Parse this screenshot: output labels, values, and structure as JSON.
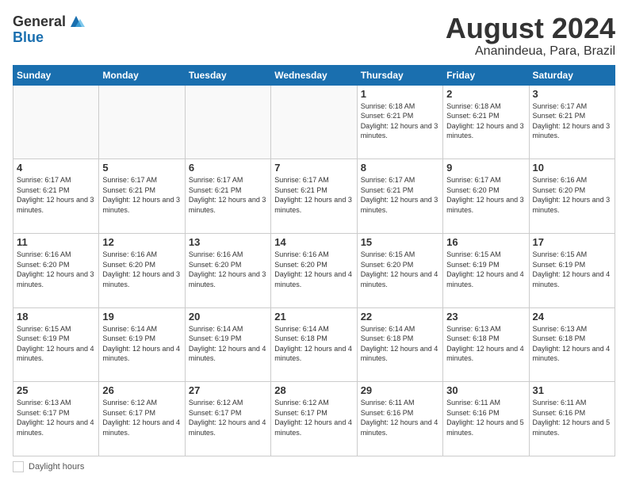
{
  "header": {
    "logo_general": "General",
    "logo_blue": "Blue",
    "title": "August 2024",
    "subtitle": "Ananindeua, Para, Brazil"
  },
  "days_of_week": [
    "Sunday",
    "Monday",
    "Tuesday",
    "Wednesday",
    "Thursday",
    "Friday",
    "Saturday"
  ],
  "footer": {
    "daylight_label": "Daylight hours"
  },
  "weeks": [
    {
      "days": [
        {
          "number": "",
          "info": ""
        },
        {
          "number": "",
          "info": ""
        },
        {
          "number": "",
          "info": ""
        },
        {
          "number": "",
          "info": ""
        },
        {
          "number": "1",
          "info": "Sunrise: 6:18 AM\nSunset: 6:21 PM\nDaylight: 12 hours and 3 minutes."
        },
        {
          "number": "2",
          "info": "Sunrise: 6:18 AM\nSunset: 6:21 PM\nDaylight: 12 hours and 3 minutes."
        },
        {
          "number": "3",
          "info": "Sunrise: 6:17 AM\nSunset: 6:21 PM\nDaylight: 12 hours and 3 minutes."
        }
      ]
    },
    {
      "days": [
        {
          "number": "4",
          "info": "Sunrise: 6:17 AM\nSunset: 6:21 PM\nDaylight: 12 hours and 3 minutes."
        },
        {
          "number": "5",
          "info": "Sunrise: 6:17 AM\nSunset: 6:21 PM\nDaylight: 12 hours and 3 minutes."
        },
        {
          "number": "6",
          "info": "Sunrise: 6:17 AM\nSunset: 6:21 PM\nDaylight: 12 hours and 3 minutes."
        },
        {
          "number": "7",
          "info": "Sunrise: 6:17 AM\nSunset: 6:21 PM\nDaylight: 12 hours and 3 minutes."
        },
        {
          "number": "8",
          "info": "Sunrise: 6:17 AM\nSunset: 6:21 PM\nDaylight: 12 hours and 3 minutes."
        },
        {
          "number": "9",
          "info": "Sunrise: 6:17 AM\nSunset: 6:20 PM\nDaylight: 12 hours and 3 minutes."
        },
        {
          "number": "10",
          "info": "Sunrise: 6:16 AM\nSunset: 6:20 PM\nDaylight: 12 hours and 3 minutes."
        }
      ]
    },
    {
      "days": [
        {
          "number": "11",
          "info": "Sunrise: 6:16 AM\nSunset: 6:20 PM\nDaylight: 12 hours and 3 minutes."
        },
        {
          "number": "12",
          "info": "Sunrise: 6:16 AM\nSunset: 6:20 PM\nDaylight: 12 hours and 3 minutes."
        },
        {
          "number": "13",
          "info": "Sunrise: 6:16 AM\nSunset: 6:20 PM\nDaylight: 12 hours and 3 minutes."
        },
        {
          "number": "14",
          "info": "Sunrise: 6:16 AM\nSunset: 6:20 PM\nDaylight: 12 hours and 4 minutes."
        },
        {
          "number": "15",
          "info": "Sunrise: 6:15 AM\nSunset: 6:20 PM\nDaylight: 12 hours and 4 minutes."
        },
        {
          "number": "16",
          "info": "Sunrise: 6:15 AM\nSunset: 6:19 PM\nDaylight: 12 hours and 4 minutes."
        },
        {
          "number": "17",
          "info": "Sunrise: 6:15 AM\nSunset: 6:19 PM\nDaylight: 12 hours and 4 minutes."
        }
      ]
    },
    {
      "days": [
        {
          "number": "18",
          "info": "Sunrise: 6:15 AM\nSunset: 6:19 PM\nDaylight: 12 hours and 4 minutes."
        },
        {
          "number": "19",
          "info": "Sunrise: 6:14 AM\nSunset: 6:19 PM\nDaylight: 12 hours and 4 minutes."
        },
        {
          "number": "20",
          "info": "Sunrise: 6:14 AM\nSunset: 6:19 PM\nDaylight: 12 hours and 4 minutes."
        },
        {
          "number": "21",
          "info": "Sunrise: 6:14 AM\nSunset: 6:18 PM\nDaylight: 12 hours and 4 minutes."
        },
        {
          "number": "22",
          "info": "Sunrise: 6:14 AM\nSunset: 6:18 PM\nDaylight: 12 hours and 4 minutes."
        },
        {
          "number": "23",
          "info": "Sunrise: 6:13 AM\nSunset: 6:18 PM\nDaylight: 12 hours and 4 minutes."
        },
        {
          "number": "24",
          "info": "Sunrise: 6:13 AM\nSunset: 6:18 PM\nDaylight: 12 hours and 4 minutes."
        }
      ]
    },
    {
      "days": [
        {
          "number": "25",
          "info": "Sunrise: 6:13 AM\nSunset: 6:17 PM\nDaylight: 12 hours and 4 minutes."
        },
        {
          "number": "26",
          "info": "Sunrise: 6:12 AM\nSunset: 6:17 PM\nDaylight: 12 hours and 4 minutes."
        },
        {
          "number": "27",
          "info": "Sunrise: 6:12 AM\nSunset: 6:17 PM\nDaylight: 12 hours and 4 minutes."
        },
        {
          "number": "28",
          "info": "Sunrise: 6:12 AM\nSunset: 6:17 PM\nDaylight: 12 hours and 4 minutes."
        },
        {
          "number": "29",
          "info": "Sunrise: 6:11 AM\nSunset: 6:16 PM\nDaylight: 12 hours and 4 minutes."
        },
        {
          "number": "30",
          "info": "Sunrise: 6:11 AM\nSunset: 6:16 PM\nDaylight: 12 hours and 5 minutes."
        },
        {
          "number": "31",
          "info": "Sunrise: 6:11 AM\nSunset: 6:16 PM\nDaylight: 12 hours and 5 minutes."
        }
      ]
    }
  ]
}
